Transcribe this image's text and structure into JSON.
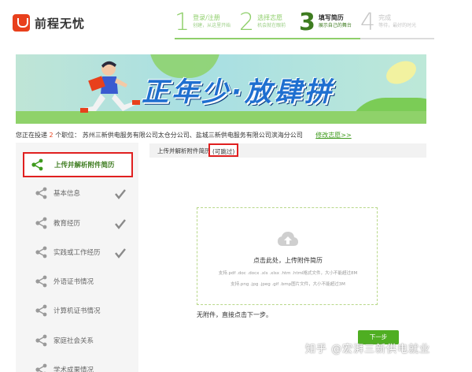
{
  "logo": {
    "text": "前程无忧"
  },
  "steps": [
    {
      "num": "1",
      "title": "登录/注册",
      "sub": "创建，从这里开始"
    },
    {
      "num": "2",
      "title": "选择志愿",
      "sub": "机会就在眼前"
    },
    {
      "num": "3",
      "title": "填写简历",
      "sub": "展示自己的舞台"
    },
    {
      "num": "4",
      "title": "完成",
      "sub": "等待，最好的时光"
    }
  ],
  "banner": {
    "title": "正年少·放肆拼"
  },
  "info": {
    "prefix": "您正在投递",
    "count": "2",
    "middle": "个职位：",
    "positions": "苏州三新供电服务有限公司太仓分公司、盐城三新供电服务有限公司滨海分公司",
    "edit_link": "修改志愿>>"
  },
  "sidebar": {
    "items": [
      {
        "label": "上传并解析附件简历",
        "checked": false,
        "active": true
      },
      {
        "label": "基本信息",
        "checked": true,
        "active": false
      },
      {
        "label": "教育经历",
        "checked": true,
        "active": false
      },
      {
        "label": "实践或工作经历",
        "checked": true,
        "active": false
      },
      {
        "label": "外语证书情况",
        "checked": false,
        "active": false
      },
      {
        "label": "计算机证书情况",
        "checked": false,
        "active": false
      },
      {
        "label": "家庭社会关系",
        "checked": false,
        "active": false
      },
      {
        "label": "学术成果情况",
        "checked": false,
        "active": false
      }
    ]
  },
  "main": {
    "head_title": "上传并解析附件简历",
    "skip": "(可跳过)",
    "upload_title": "点击此处，上传附件简历",
    "upload_hint1": "支持.pdf .doc .docx .xls .xlsx .htm .html格式文件，大小不能超过8M",
    "upload_hint2": "支持.png .jpg .jpeg .gif .bmp图片文件，大小不能超过3M",
    "no_attach": "无附件，直接点击下一步。",
    "next": "下一步"
  },
  "watermark": "知乎 @宏湃三新供电就业",
  "colors": {
    "accent": "#4fae22",
    "highlight": "#e02020",
    "brand": "#e8401c"
  }
}
